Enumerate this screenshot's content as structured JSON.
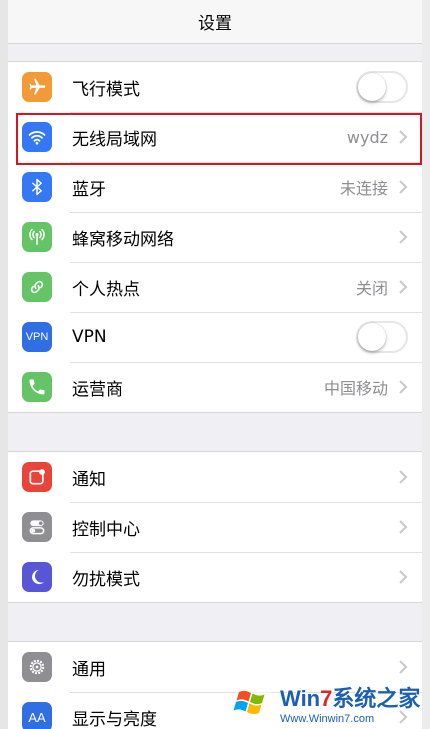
{
  "nav": {
    "title": "设置"
  },
  "groups": [
    {
      "rows": [
        {
          "label": "飞行模式",
          "icon": "airplane-icon",
          "color": "#f19a37",
          "toggle": "off"
        },
        {
          "label": "无线局域网",
          "icon": "wifi-icon",
          "color": "#3478f6",
          "value": "wydz"
        },
        {
          "label": "蓝牙",
          "icon": "bluetooth-icon",
          "color": "#3478f6",
          "value": "未连接"
        },
        {
          "label": "蜂窝移动网络",
          "icon": "cellular-icon",
          "color": "#65c466"
        },
        {
          "label": "个人热点",
          "icon": "hotspot-icon",
          "color": "#65c466",
          "value": "关闭"
        },
        {
          "label": "VPN",
          "icon": "vpn-icon",
          "icon_text": "VPN",
          "color": "#2f6ee3",
          "toggle": "off"
        },
        {
          "label": "运营商",
          "icon": "phone-icon",
          "color": "#65c466",
          "value": "中国移动"
        }
      ]
    },
    {
      "rows": [
        {
          "label": "通知",
          "icon": "notification-icon",
          "color": "#e8443a"
        },
        {
          "label": "控制中心",
          "icon": "control-center-icon",
          "color": "#8e8e93"
        },
        {
          "label": "勿扰模式",
          "icon": "moon-icon",
          "color": "#5856d6"
        }
      ]
    },
    {
      "rows": [
        {
          "label": "通用",
          "icon": "gear-icon",
          "color": "#8e8e93"
        },
        {
          "label": "显示与亮度",
          "icon": "display-icon",
          "icon_text": "AA",
          "color": "#2f6ee3"
        }
      ]
    }
  ],
  "watermark": {
    "main_a": "Win",
    "main_b": "7",
    "main_c": "系统之家",
    "url": "Www.Winwin7.com"
  },
  "highlight_color": "#d6161c"
}
